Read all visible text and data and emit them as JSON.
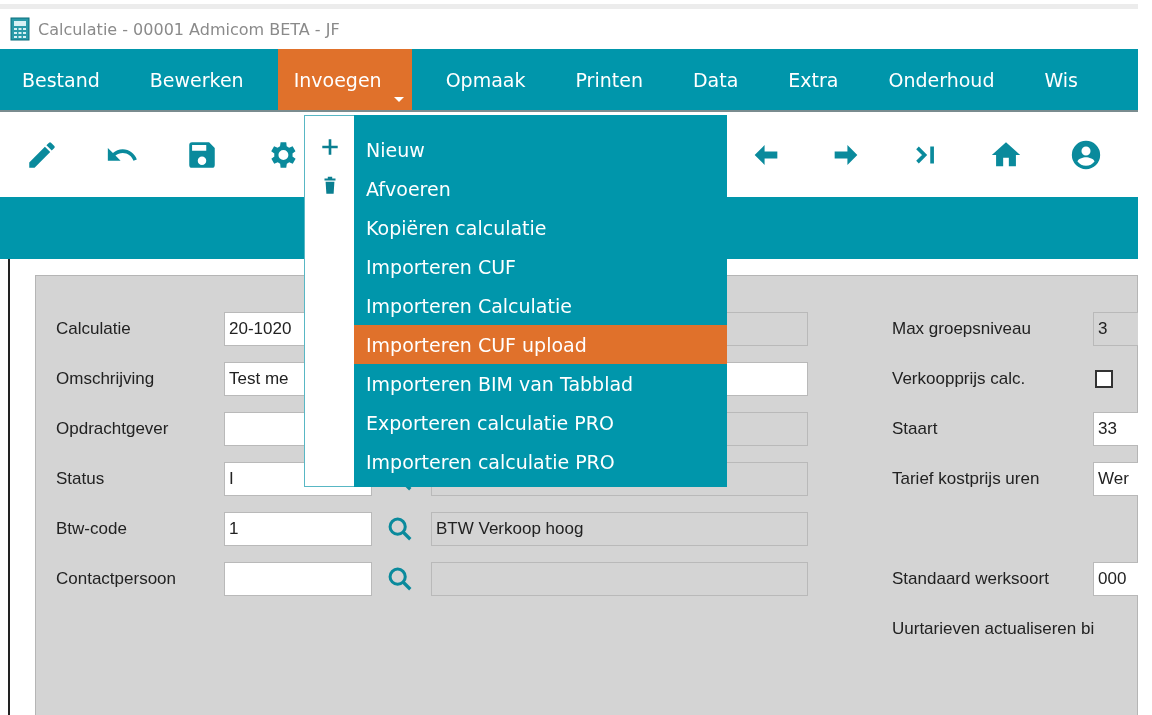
{
  "window": {
    "title": "Calculatie - 00001 Admicom BETA - JF"
  },
  "menubar": [
    {
      "label": "Bestand",
      "selected": false
    },
    {
      "label": "Bewerken",
      "selected": false
    },
    {
      "label": "Invoegen",
      "selected": true
    },
    {
      "label": "Opmaak",
      "selected": false
    },
    {
      "label": "Printen",
      "selected": false
    },
    {
      "label": "Data",
      "selected": false
    },
    {
      "label": "Extra",
      "selected": false
    },
    {
      "label": "Onderhoud",
      "selected": false
    },
    {
      "label": "Wis",
      "selected": false
    }
  ],
  "dropdown": {
    "items": [
      {
        "label": "Nieuw",
        "selected": false
      },
      {
        "label": "Afvoeren",
        "selected": false
      },
      {
        "label": "Kopiëren calculatie",
        "selected": false
      },
      {
        "label": "Importeren CUF",
        "selected": false
      },
      {
        "label": "Importeren Calculatie",
        "selected": false
      },
      {
        "label": "Importeren CUF upload",
        "selected": true
      },
      {
        "label": "Importeren BIM van Tabblad",
        "selected": false
      },
      {
        "label": "Exporteren calculatie PRO",
        "selected": false
      },
      {
        "label": "Importeren calculatie PRO",
        "selected": false
      }
    ]
  },
  "left_fields": [
    {
      "label": "Calculatie",
      "kind": "code",
      "value": "20-1020"
    },
    {
      "label": "Omschrijving",
      "kind": "wide",
      "value": "Test me"
    },
    {
      "label": "Opdrachtgever",
      "kind": "code"
    },
    {
      "label": "Status",
      "kind": "lookup",
      "value": "I"
    },
    {
      "label": "Btw-code",
      "kind": "lookup",
      "value": "1",
      "description": "BTW Verkoop hoog"
    },
    {
      "label": "Contactpersoon",
      "kind": "lookup"
    }
  ],
  "right_groups": [
    [
      {
        "label": "Max groepsniveau",
        "kind": "readonly",
        "value": "3"
      },
      {
        "label": "Verkoopprijs calc.",
        "kind": "checkbox",
        "checked": false
      },
      {
        "label": "Staart",
        "kind": "input",
        "value": "33"
      },
      {
        "label": "Tarief kostprijs uren",
        "kind": "input",
        "value": "Wer"
      }
    ],
    [
      {
        "label": "Standaard werksoort",
        "kind": "input",
        "value": "000"
      },
      {
        "label": "Uurtarieven actualiseren bi",
        "kind": "text"
      }
    ]
  ]
}
